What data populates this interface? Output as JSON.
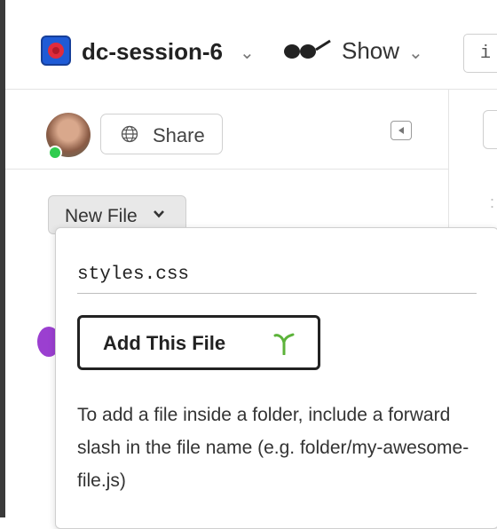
{
  "header": {
    "project_name": "dc-session-6",
    "project_logo_icon": "project-logo-icon",
    "show_label": "Show",
    "glasses_icon": "glasses-icon",
    "right_input_text": "i"
  },
  "sidebar": {
    "share_label": "Share",
    "new_file_label": "New File"
  },
  "new_file_popover": {
    "filename_value": "styles.css",
    "add_button_label": "Add This File",
    "hint_text": "To add a file inside a folder, include a forward slash in the file name (e.g. folder/my-awesome-file.js)"
  },
  "colors": {
    "status_online": "#2fcc4f",
    "sprout_green": "#5cb33a",
    "logo_blue": "#1f5bd6",
    "logo_red": "#e12c3c",
    "collaborator_purple": "#9b3fd0"
  }
}
